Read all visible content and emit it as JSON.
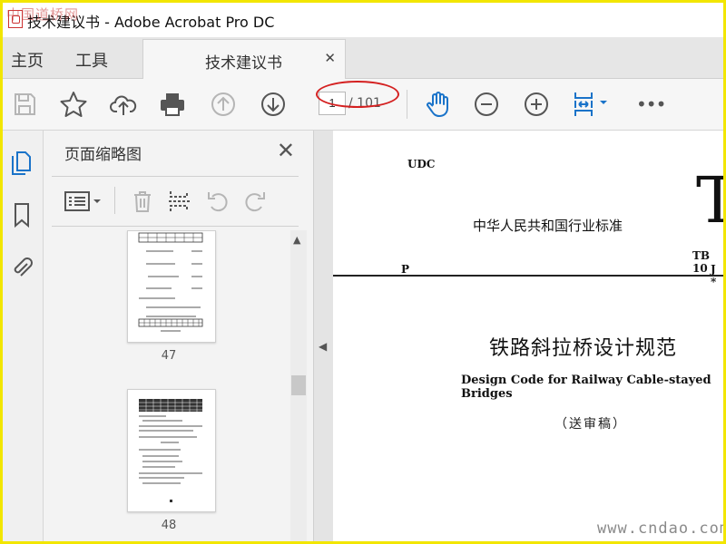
{
  "window": {
    "title": "技术建议书 - Adobe Acrobat Pro DC"
  },
  "watermarks": {
    "top_left": "中国道桥网",
    "bottom_right": "www.cndao.com"
  },
  "tabs": {
    "home": "主页",
    "tools": "工具",
    "document": "技术建议书"
  },
  "toolbar": {
    "icons": [
      "save-icon",
      "star-icon",
      "cloud-upload-icon",
      "print-icon",
      "page-up-icon",
      "page-down-icon",
      "hand-tool-icon",
      "zoom-out-icon",
      "zoom-in-icon",
      "fit-page-icon",
      "more-icon"
    ],
    "page_current": "1",
    "page_total": "/ 101",
    "more_label": "•••"
  },
  "sidebar": {
    "icons": [
      "page-thumbnails-icon",
      "bookmark-icon",
      "attachment-icon"
    ]
  },
  "thumbnail_panel": {
    "title": "页面缩略图",
    "close": "✕",
    "thumbnails": [
      {
        "page": "47"
      },
      {
        "page": "48"
      }
    ]
  },
  "document": {
    "udc": "UDC",
    "big_letter": "T",
    "standard_category": "中华人民共和国行业标准",
    "standard_no": "TB 10",
    "p_label": "P",
    "j_label": "J *",
    "title_cn": "铁路斜拉桥设计规范",
    "title_en": "Design Code for Railway Cable-stayed Bridges",
    "draft_status": "（送审稿）"
  },
  "colors": {
    "accent": "#1a73c9",
    "annotation": "#d42020",
    "frame": "#f2e600"
  }
}
